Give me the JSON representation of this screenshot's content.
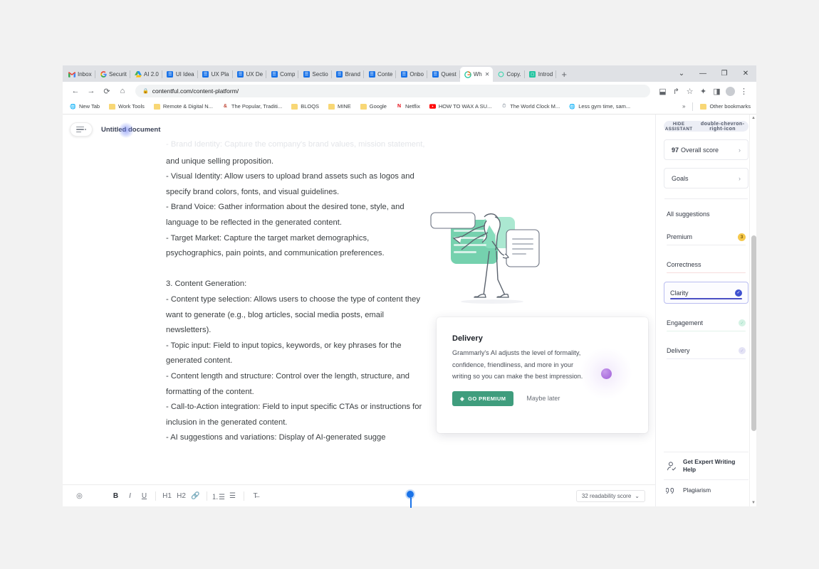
{
  "browser": {
    "tabs": [
      {
        "label": "Inbox",
        "icon": "gmail-icon",
        "active": false
      },
      {
        "label": "Securit",
        "icon": "google-icon",
        "active": false
      },
      {
        "label": "AI 2.0",
        "icon": "drive-icon",
        "active": false
      },
      {
        "label": "UI Idea",
        "icon": "docs-icon",
        "active": false
      },
      {
        "label": "UX Pla",
        "icon": "docs-icon",
        "active": false
      },
      {
        "label": "UX De",
        "icon": "docs-icon",
        "active": false
      },
      {
        "label": "Comp",
        "icon": "docs-icon",
        "active": false
      },
      {
        "label": "Sectio",
        "icon": "docs-icon",
        "active": false
      },
      {
        "label": "Brand",
        "icon": "docs-icon",
        "active": false
      },
      {
        "label": "Conte",
        "icon": "docs-icon",
        "active": false
      },
      {
        "label": "Onbo",
        "icon": "docs-icon",
        "active": false
      },
      {
        "label": "Quest",
        "icon": "docs-icon",
        "active": false
      },
      {
        "label": "Wh",
        "icon": "grammarly-icon",
        "active": true
      },
      {
        "label": "Copy.",
        "icon": "copy-ai-icon",
        "active": false
      },
      {
        "label": "Introd",
        "icon": "intro-icon",
        "active": false
      }
    ],
    "new_tab_label": "+",
    "window_controls": {
      "tab_search": "chevron-down-icon",
      "minimize": "minimize-icon",
      "maximize": "maximize-icon",
      "close": "close-icon"
    },
    "nav": {
      "back": "back-arrow-icon",
      "forward": "forward-arrow-icon",
      "reload": "reload-icon",
      "home": "home-icon",
      "url": "contentful.com/content-platform/",
      "lock": "lock-icon",
      "install": "install-icon",
      "share": "share-icon",
      "bookmark": "star-icon",
      "extensions": "puzzle-icon",
      "sidepanel": "side-panel-icon",
      "profile": "avatar-icon",
      "menu": "kebab-menu-icon"
    },
    "bookmarks": [
      {
        "label": "New Tab",
        "icon": "globe-icon"
      },
      {
        "label": "Work Tools",
        "icon": "folder-icon"
      },
      {
        "label": "Remote & Digital N...",
        "icon": "folder-icon"
      },
      {
        "label": "The Popular, Traditi...",
        "icon": "ampersand-icon"
      },
      {
        "label": "BLOQS",
        "icon": "folder-icon"
      },
      {
        "label": "MINE",
        "icon": "folder-icon"
      },
      {
        "label": "Google",
        "icon": "folder-icon"
      },
      {
        "label": "Netflix",
        "icon": "netflix-icon"
      },
      {
        "label": "HOW TO WAX A SU...",
        "icon": "youtube-icon"
      },
      {
        "label": "The World Clock M...",
        "icon": "clock-icon"
      },
      {
        "label": "Less gym time, sam...",
        "icon": "globe-icon"
      }
    ],
    "bookmarks_overflow": "»",
    "other_bookmarks": "Other bookmarks"
  },
  "document": {
    "title": "Untitled document",
    "menu_icon": "document-menu-icon",
    "lines": [
      {
        "text": "- Brand Identity: Capture the company's brand values, mission statement,",
        "faded": true
      },
      {
        "text": "and unique selling proposition.",
        "faded": false
      },
      {
        "text": "- Visual Identity: Allow users to upload brand assets such as logos and",
        "faded": false
      },
      {
        "text": "specify brand colors, fonts, and visual guidelines.",
        "faded": false
      },
      {
        "text": "- Brand Voice: Gather information about the desired tone, style, and",
        "faded": false
      },
      {
        "text": "language to be reflected in the generated content.",
        "faded": false
      },
      {
        "text": "- Target Market: Capture the target market demographics,",
        "faded": false
      },
      {
        "text": "psychographics, pain points, and communication preferences.",
        "faded": false
      },
      {
        "text": "",
        "faded": false
      },
      {
        "text": "3. Content Generation:",
        "faded": false
      },
      {
        "text": "- Content type selection: Allows users to choose the type of content they",
        "faded": false
      },
      {
        "text": "want to generate (e.g., blog articles, social media posts, email",
        "faded": false
      },
      {
        "text": "newsletters).",
        "faded": false
      },
      {
        "text": "- Topic input: Field to input topics, keywords, or key phrases for the",
        "faded": false
      },
      {
        "text": "generated content.",
        "faded": false
      },
      {
        "text": "- Content length and structure: Control over the length, structure, and",
        "faded": false
      },
      {
        "text": "formatting of the content.",
        "faded": false
      },
      {
        "text": "- Call-to-Action integration: Field to input specific CTAs or instructions for",
        "faded": false
      },
      {
        "text": "inclusion in the generated content.",
        "faded": false
      },
      {
        "text": "- AI suggestions and variations: Display of AI-generated sugge",
        "faded": false
      }
    ]
  },
  "editor_toolbar": {
    "help": "?",
    "bold": "B",
    "italic": "I",
    "underline": "U",
    "h1": "H1",
    "h2": "H2",
    "link": "link-icon",
    "numbered_list": "numbered-list-icon",
    "bullet_list": "bullet-list-icon",
    "clear_format": "clear-format-icon",
    "readability_label": "32 readability score",
    "readability_caret": "⌄"
  },
  "promo": {
    "heading": "Delivery",
    "body": "Grammarly's AI adjusts the level of formality, confidence, friendliness, and more in your writing so you can make the best impression.",
    "primary_button": "GO PREMIUM",
    "primary_icon": "diamond-icon",
    "secondary_button": "Maybe later"
  },
  "assistant": {
    "hide_label": "HIDE ASSISTANT",
    "hide_icon": "double-chevron-right-icon",
    "overall_score_value": "97",
    "overall_score_label": "Overall score",
    "goals_label": "Goals",
    "chevron": "›",
    "all_suggestions_label": "All suggestions",
    "categories": [
      {
        "label": "Premium",
        "badge": "3",
        "state": "badge",
        "underline": "#ececef"
      },
      {
        "label": "Correctness",
        "badge": "",
        "state": "none",
        "underline": "#f6dcdc"
      },
      {
        "label": "Clarity",
        "badge": "check",
        "state": "selected",
        "underline": "#4a4fc4"
      },
      {
        "label": "Engagement",
        "badge": "check-light-green",
        "state": "none",
        "underline": "#dff3e8"
      },
      {
        "label": "Delivery",
        "badge": "check-light-purple",
        "state": "none",
        "underline": "#e8e8f5"
      }
    ],
    "bottom_links": [
      {
        "label": "Get Expert Writing Help",
        "icon": "expert-writer-icon"
      },
      {
        "label": "Plagiarism",
        "icon": "quote-marks-icon"
      }
    ]
  },
  "colors": {
    "accent_green": "#3f9d7d",
    "accent_blue": "#4a4fc4",
    "badge_yellow": "#f5c84c",
    "browser_chrome": "#dfe1e5",
    "cursor_blue": "#1a73e8"
  }
}
